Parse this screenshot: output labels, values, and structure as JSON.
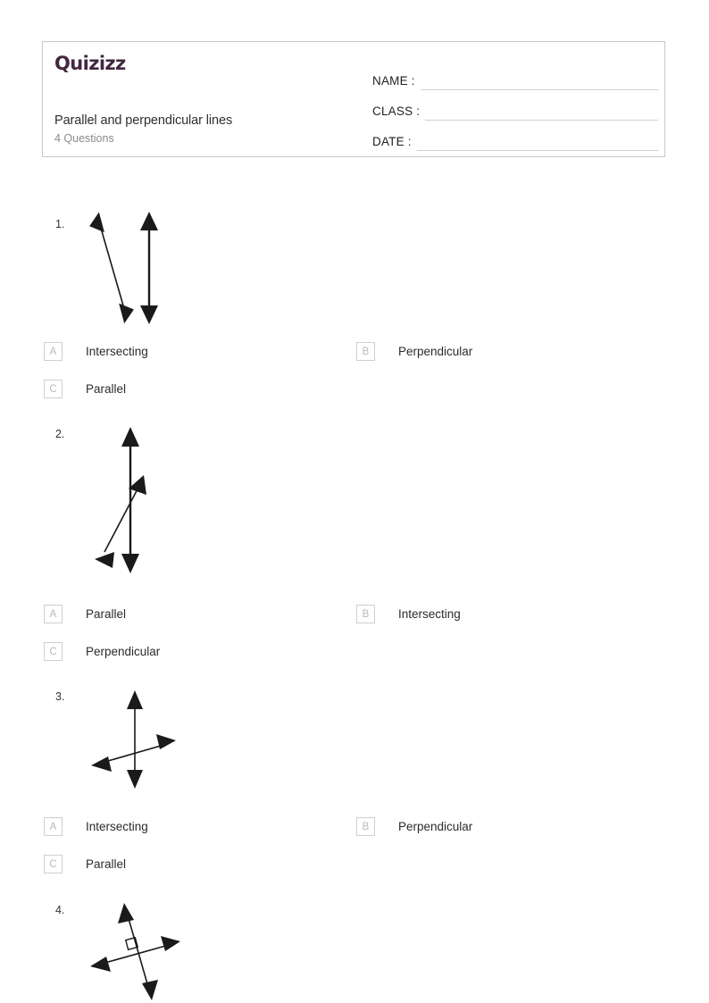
{
  "header": {
    "brand": "Quizizz",
    "title": "Parallel and perpendicular lines",
    "subtitle": "4 Questions",
    "fields": [
      {
        "label": "NAME :"
      },
      {
        "label": "CLASS :"
      },
      {
        "label": "DATE  :"
      }
    ]
  },
  "questions": [
    {
      "number": "1.",
      "figure": "two-lines-slanted-and-vertical",
      "options": [
        {
          "letter": "A",
          "label": "Intersecting"
        },
        {
          "letter": "B",
          "label": "Perpendicular"
        },
        {
          "letter": "C",
          "label": "Parallel"
        }
      ]
    },
    {
      "number": "2.",
      "figure": "vertical-line-crossed-by-diagonal",
      "options": [
        {
          "letter": "A",
          "label": "Parallel"
        },
        {
          "letter": "B",
          "label": "Intersecting"
        },
        {
          "letter": "C",
          "label": "Perpendicular"
        }
      ]
    },
    {
      "number": "3.",
      "figure": "vertical-line-crossed-by-horizontal",
      "options": [
        {
          "letter": "A",
          "label": "Intersecting"
        },
        {
          "letter": "B",
          "label": "Perpendicular"
        },
        {
          "letter": "C",
          "label": "Parallel"
        }
      ]
    },
    {
      "number": "4.",
      "figure": "perpendicular-lines-with-right-angle-mark",
      "options": []
    }
  ],
  "colors": {
    "brand": "#42273f",
    "line": "#1a1a1a",
    "border": "#c9c9c9",
    "badge_text": "#b9b9b9",
    "muted_text": "#8a8a8a"
  }
}
